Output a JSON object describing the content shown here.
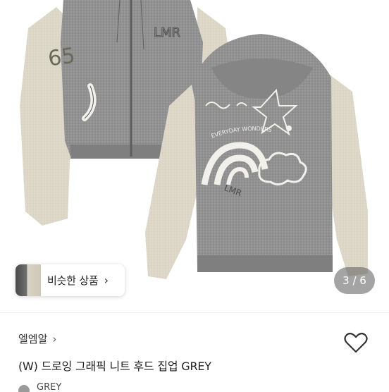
{
  "gallery": {
    "similar_label": "비슷한 상품",
    "chevron_glyph": "›",
    "page_counter": "3 / 6",
    "current_page": 3,
    "total_pages": 6
  },
  "product": {
    "brand": "엘엠알",
    "brand_chevron": "›",
    "title": "(W) 드로잉 그래픽 니트 후드 집업 GREY",
    "color_label": "GREY",
    "liked": false
  },
  "artwork": {
    "front_text_1": "LMR",
    "front_text_2": "65",
    "back_arc_text": "EVERYDAY WONDERS",
    "back_text": "LMR"
  },
  "colors": {
    "knit_grey": "#8f8f8f",
    "sleeve_cream": "#ddd8c8",
    "counter_bg": "#7a7a7a",
    "heart_stroke": "#333333"
  },
  "icons": {
    "wish": "heart-outline-icon",
    "chevron": "chevron-right-icon"
  }
}
